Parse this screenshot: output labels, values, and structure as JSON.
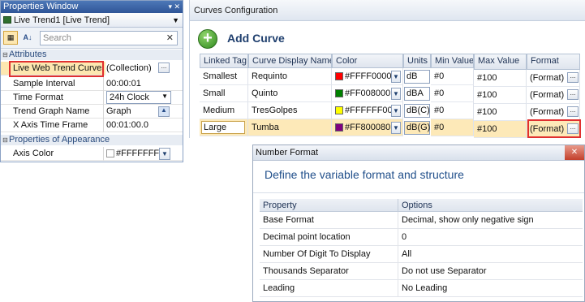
{
  "properties_window": {
    "title": "Properties Window",
    "title_controls": "▾ ✕",
    "object_selector": "Live Trend1 [Live Trend]",
    "search_placeholder": "Search",
    "groups": {
      "attributes": "Attributes",
      "appearance": "Properties of Appearance"
    },
    "rows": [
      {
        "name": "Live Web Trend Curves",
        "value": "(Collection)"
      },
      {
        "name": "Sample Interval",
        "value": "00:00:01"
      },
      {
        "name": "Time Format",
        "value": "24h Clock"
      },
      {
        "name": "Trend Graph Name",
        "value": "Graph"
      },
      {
        "name": "X Axis Time Frame",
        "value": "00:01:00.0"
      },
      {
        "name": "Axis Color",
        "value": "#FFFFFFFF"
      }
    ]
  },
  "curves_configuration": {
    "title": "Curves Configuration",
    "add_label": "Add Curve",
    "columns": [
      "Linked Tag",
      "Curve Display Name",
      "Color",
      "Units",
      "Min Value",
      "Max Value",
      "Format"
    ],
    "rows": [
      {
        "tag": "Smallest",
        "name": "Requinto",
        "color": "#FFFF0000",
        "swatch": "#ff0000",
        "units": "dB",
        "min": "#0",
        "max": "#100",
        "format": "(Format)"
      },
      {
        "tag": "Small",
        "name": "Quinto",
        "color": "#FF008000",
        "swatch": "#008000",
        "units": "dBA",
        "min": "#0",
        "max": "#100",
        "format": "(Format)"
      },
      {
        "tag": "Medium",
        "name": "TresGolpes",
        "color": "#FFFFFF00",
        "swatch": "#ffff00",
        "units": "dB(C)",
        "min": "#0",
        "max": "#100",
        "format": "(Format)"
      },
      {
        "tag": "Large",
        "name": "Tumba",
        "color": "#FF800080",
        "swatch": "#800080",
        "units": "dB(G)",
        "min": "#0",
        "max": "#100",
        "format": "(Format)"
      }
    ]
  },
  "number_format": {
    "title": "Number Format",
    "heading": "Define the variable format and structure",
    "columns": [
      "Property",
      "Options"
    ],
    "rows": [
      {
        "property": "Base Format",
        "option": "Decimal, show only negative sign"
      },
      {
        "property": "Decimal point location",
        "option": "0"
      },
      {
        "property": "Number Of Digit To Display",
        "option": "All"
      },
      {
        "property": "Thousands Separator",
        "option": "Do not use Separator"
      },
      {
        "property": "Leading",
        "option": "No Leading"
      }
    ]
  },
  "colors": {
    "accent_red": "#e03030",
    "selection": "#fde9b8",
    "title_blue": "#1f4e8a"
  }
}
